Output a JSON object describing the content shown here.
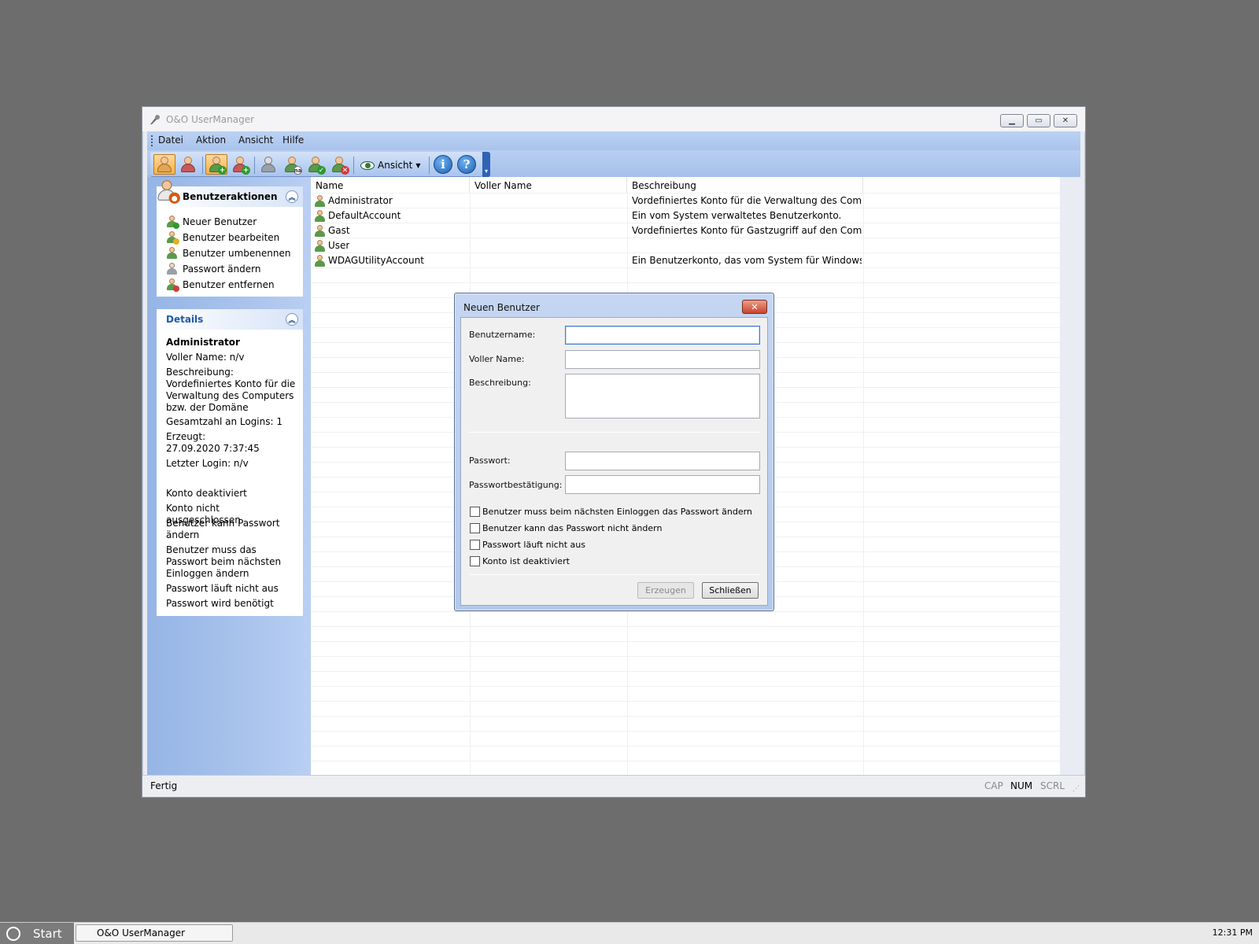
{
  "window": {
    "title": "O&O UserManager",
    "controls": {
      "minimize": "minimize-icon",
      "maximize": "maximize-icon",
      "close": "close-icon"
    }
  },
  "menu": [
    "Datei",
    "Aktion",
    "Ansicht",
    "Hilfe"
  ],
  "toolbar": {
    "ansicht_label": "Ansicht",
    "icons": [
      "users-view-icon",
      "groups-view-icon",
      "add-user-icon",
      "add-group-icon",
      "password-icon",
      "rename-user-icon",
      "edit-user-icon",
      "remove-user-icon",
      "eye-icon",
      "info-icon",
      "help-icon"
    ]
  },
  "sidebar": {
    "actions_title": "Benutzeraktionen",
    "actions": [
      {
        "label": "Neuer Benutzer",
        "icon": "add-user-icon"
      },
      {
        "label": "Benutzer bearbeiten",
        "icon": "edit-user-icon"
      },
      {
        "label": "Benutzer umbenennen",
        "icon": "rename-user-icon"
      },
      {
        "label": "Passwort ändern",
        "icon": "password-icon"
      },
      {
        "label": "Benutzer entfernen",
        "icon": "remove-user-icon"
      }
    ],
    "details_title": "Details",
    "details": {
      "user": "Administrator",
      "full_name": "Voller Name: n/v",
      "description_label": "Beschreibung:",
      "description": "Vordefiniertes Konto für die Verwaltung des Computers bzw. der Domäne",
      "logins": "Gesamtzahl an Logins: 1",
      "created_label": "Erzeugt:",
      "created": "27.09.2020 7:37:45",
      "last_login": "Letzter Login: n/v",
      "flags": [
        "Konto deaktiviert",
        "Konto nicht ausgeschlossen",
        "Benutzer kann Passwort ändern",
        "Benutzer muss das Passwort beim nächsten Einloggen ändern",
        "Passwort läuft nicht aus",
        "Passwort wird benötigt"
      ]
    }
  },
  "list": {
    "columns": [
      "Name",
      "Voller Name",
      "Beschreibung"
    ],
    "rows": [
      {
        "name": "Administrator",
        "full_name": "",
        "description": "Vordefiniertes Konto für die Verwaltung des Comput..."
      },
      {
        "name": "DefaultAccount",
        "full_name": "",
        "description": "Ein vom System verwaltetes Benutzerkonto."
      },
      {
        "name": "Gast",
        "full_name": "",
        "description": "Vordefiniertes Konto für Gastzugriff auf den Comput..."
      },
      {
        "name": "User",
        "full_name": "",
        "description": ""
      },
      {
        "name": "WDAGUtilityAccount",
        "full_name": "",
        "description": "Ein Benutzerkonto, das vom System für Windows Def..."
      }
    ]
  },
  "status": {
    "text": "Fertig",
    "cap": "CAP",
    "num": "NUM",
    "scrl": "SCRL"
  },
  "dialog": {
    "title": "Neuen Benutzer",
    "username_label": "Benutzername:",
    "username_value": "",
    "fullname_label": "Voller Name:",
    "fullname_value": "",
    "description_label": "Beschreibung:",
    "description_value": "",
    "password_label": "Passwort:",
    "password_confirm_label": "Passwortbestätigung:",
    "checkboxes": [
      {
        "label": "Benutzer muss beim nächsten Einloggen das Passwort ändern",
        "checked": false
      },
      {
        "label": "Benutzer kann das Passwort nicht ändern",
        "checked": false
      },
      {
        "label": "Passwort läuft nicht aus",
        "checked": false
      },
      {
        "label": "Konto ist deaktiviert",
        "checked": false
      }
    ],
    "create_button": "Erzeugen",
    "close_button": "Schließen"
  },
  "taskbar": {
    "start": "Start",
    "task": "O&O UserManager",
    "clock": "12:31 PM"
  }
}
